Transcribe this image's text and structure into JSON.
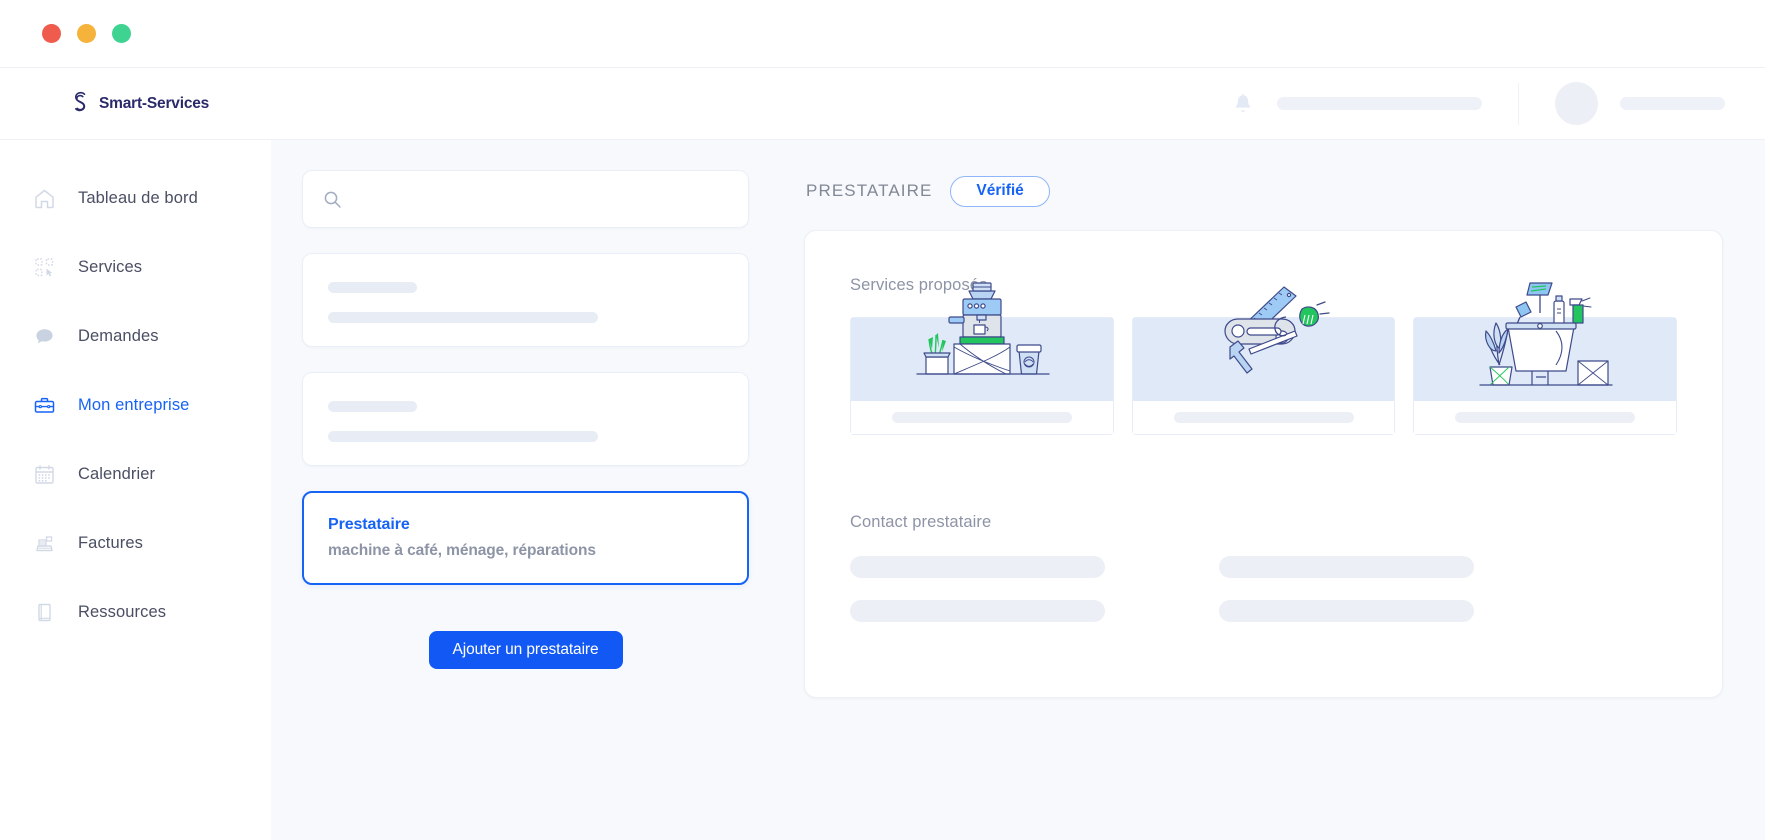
{
  "window": {
    "traffic_lights": [
      "close",
      "minimize",
      "maximize"
    ],
    "colors": {
      "close": "#ef5b4d",
      "minimize": "#f5b33c",
      "maximize": "#3fd392"
    }
  },
  "header": {
    "brand_name": "Smart-Services",
    "brand_icon": "smart-services-logo-icon",
    "bell_icon": "notification-bell-icon",
    "avatar": "user-avatar"
  },
  "sidebar": {
    "items": [
      {
        "label": "Tableau de bord",
        "icon": "home-icon",
        "active": false
      },
      {
        "label": "Services",
        "icon": "services-grid-icon",
        "active": false
      },
      {
        "label": "Demandes",
        "icon": "chat-bubble-icon",
        "active": false
      },
      {
        "label": "Mon entreprise",
        "icon": "briefcase-icon",
        "active": true
      },
      {
        "label": "Calendrier",
        "icon": "calendar-icon",
        "active": false
      },
      {
        "label": "Factures",
        "icon": "cash-register-icon",
        "active": false
      },
      {
        "label": "Ressources",
        "icon": "book-icon",
        "active": false
      }
    ]
  },
  "list_panel": {
    "search": {
      "value": "",
      "placeholder": "",
      "icon": "search-icon"
    },
    "selected_card": {
      "title": "Prestataire",
      "subtitle": "machine à café, ménage, réparations"
    },
    "add_button": "Ajouter un prestataire"
  },
  "detail_panel": {
    "title": "PRESTATAIRE",
    "badge": "Vérifié",
    "services_label": "Services proposés",
    "contact_label": "Contact prestataire",
    "services": [
      {
        "icon": "coffee-machine-illustration"
      },
      {
        "icon": "tools-multitool-illustration"
      },
      {
        "icon": "cleaning-bucket-illustration"
      }
    ],
    "contact_fields": 4
  },
  "theme": {
    "accent": "#1763f5",
    "button": "#1258f5",
    "text_muted": "#8d94a5",
    "nav_text": "#4a4f63",
    "skeleton": "#eceff6",
    "illu_bg": "#dfe9f7",
    "canvas": "#f7f9fc"
  }
}
